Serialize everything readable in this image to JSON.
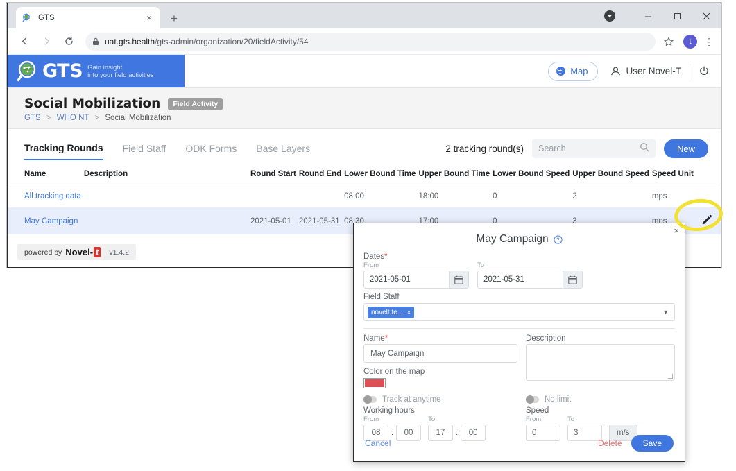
{
  "browser": {
    "tab": {
      "title": "GTS",
      "favicon": "gts-favicon",
      "close_label": "×"
    },
    "new_tab_label": "+",
    "nav": {
      "back": "←",
      "forward": "→",
      "reload": "↻"
    },
    "omnibox": {
      "lock": "lock-icon",
      "url_main": "uat.gts.health",
      "url_path": "/gts-admin/organization/20/fieldActivity/54",
      "star": "☆",
      "profile_initial": "t",
      "menu": "⋮"
    },
    "window_controls": {
      "minimize": "–",
      "maximize": "□",
      "close": "✕"
    }
  },
  "app_header": {
    "logo_text": "GTS",
    "tagline_line1": "Gain insight",
    "tagline_line2": "into your field activities",
    "map_button": "Map",
    "user_name": "User Novel-T",
    "logout_icon": "power-icon"
  },
  "page": {
    "title": "Social Mobilization",
    "badge": "Field Activity",
    "breadcrumb": [
      {
        "label": "GTS",
        "link": true
      },
      {
        "label": "WHO NT",
        "link": true
      },
      {
        "label": "Social Mobilization",
        "link": false
      }
    ],
    "separator": ">"
  },
  "tabs": [
    {
      "label": "Tracking Rounds",
      "active": true
    },
    {
      "label": "Field Staff",
      "active": false
    },
    {
      "label": "ODK Forms",
      "active": false
    },
    {
      "label": "Base Layers",
      "active": false
    }
  ],
  "toolbar": {
    "count_text": "2 tracking round(s)",
    "search_placeholder": "Search",
    "search_value": "",
    "new_label": "New"
  },
  "table": {
    "columns": [
      "Name",
      "Description",
      "Round Start",
      "Round End",
      "Lower Bound Time",
      "Upper Bound Time",
      "Lower Bound Speed",
      "Upper Bound Speed",
      "Speed Unit"
    ],
    "rows": [
      {
        "name": "All tracking data",
        "description": "",
        "round_start": "",
        "round_end": "",
        "lower_bound_time": "08:00",
        "upper_bound_time": "18:00",
        "lower_bound_speed": "0",
        "upper_bound_speed": "2",
        "speed_unit": "mps",
        "edit": ""
      },
      {
        "name": "May Campaign",
        "description": "",
        "round_start": "2021-05-01",
        "round_end": "2021-05-31",
        "lower_bound_time": "08:30",
        "upper_bound_time": "17:00",
        "lower_bound_speed": "0",
        "upper_bound_speed": "3",
        "speed_unit": "mps",
        "edit": "edit-pencil-icon"
      }
    ]
  },
  "footer": {
    "powered_by": "powered by",
    "brand": "Novel-",
    "brand_mark": "t",
    "version": "v1.4.2"
  },
  "modal": {
    "title": "May Campaign",
    "help_icon": "?",
    "close_label": "×",
    "dates_label": "Dates",
    "required_mark": "*",
    "from_label": "From",
    "to_label": "To",
    "date_from": "2021-05-01",
    "date_to": "2021-05-31",
    "calendar_icon": "calendar-icon",
    "field_staff_label": "Field Staff",
    "field_staff_chip": "novelt.te...",
    "chip_remove": "×",
    "name_label": "Name",
    "name_value": "May Campaign",
    "description_label": "Description",
    "description_value": "",
    "color_label": "Color on the map",
    "color_value": "#de4f56",
    "track_anytime_label": "Track at anytime",
    "track_anytime_on": false,
    "no_limit_label": "No limit",
    "no_limit_on": false,
    "working_hours_label": "Working hours",
    "speed_label": "Speed",
    "wh_from_hour": "08",
    "wh_from_min": "00",
    "wh_to_hour": "17",
    "wh_to_min": "00",
    "time_separator": ":",
    "speed_from": "0",
    "speed_to": "3",
    "speed_unit": "m/s",
    "cancel_label": "Cancel",
    "delete_label": "Delete",
    "save_label": "Save"
  },
  "annotation": {
    "highlight_color": "#f2e130",
    "target": "edit-pencil-icon"
  }
}
